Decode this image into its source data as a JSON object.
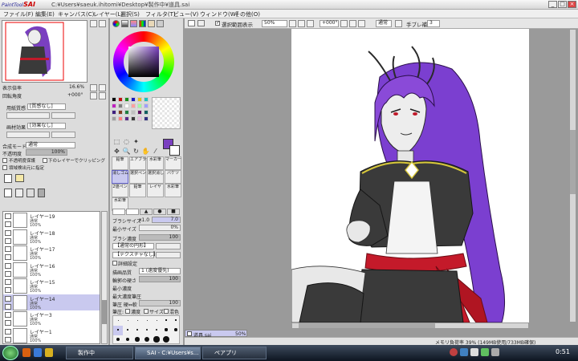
{
  "window": {
    "logo_top": "PaintTool",
    "logo_main": "SAI",
    "title": "C:¥Users¥saeuk.ihitomi¥Desktop¥製作中¥道具.sai",
    "buttons": [
      "_",
      "□",
      "×"
    ]
  },
  "menu": [
    "ファイル(F)",
    "編集(E)",
    "キャンバス(C)",
    "レイヤー(L)",
    "選択(S)",
    "フィルタ(T)",
    "ビュー(V)",
    "ウィンドウ(W)",
    "その他(O)"
  ],
  "navigator": {
    "zoom_label": "表示倍率",
    "zoom_value": "16.6%",
    "angle_label": "回転角度",
    "angle_value": "+000°"
  },
  "layer_props": {
    "paper_label": "用紙質感",
    "paper_value": "[質感なし]",
    "effect_label": "画材効果",
    "effect_value": "[効果なし]",
    "blend_label": "合成モード",
    "blend_value": "通常",
    "opacity_label": "不透明度",
    "opacity_value": "100%",
    "check_protect": "不透明度保護",
    "check_clip": "下のレイヤーでクリッピング",
    "check_select": "領域検出元に指定"
  },
  "layers": [
    {
      "name": "レイヤー19",
      "mode": "通常",
      "opacity": "100%",
      "selected": false
    },
    {
      "name": "レイヤー18",
      "mode": "通常",
      "opacity": "100%",
      "selected": false
    },
    {
      "name": "レイヤー17",
      "mode": "通常",
      "opacity": "100%",
      "selected": false
    },
    {
      "name": "レイヤー16",
      "mode": "通常",
      "opacity": "100%",
      "selected": false
    },
    {
      "name": "レイヤー15",
      "mode": "通常",
      "opacity": "100%",
      "selected": false
    },
    {
      "name": "レイヤー14",
      "mode": "通常",
      "opacity": "100%",
      "selected": true
    },
    {
      "name": "レイヤー3",
      "mode": "通常",
      "opacity": "100%",
      "selected": false
    },
    {
      "name": "レイヤー1",
      "mode": "通常",
      "opacity": "100%",
      "selected": false
    }
  ],
  "brushes": [
    "鉛筆",
    "エアブラシ",
    "水彩筆",
    "マーカー",
    "消しゴム",
    "選択ペン",
    "選択消し",
    "バケツ",
    "2値ペン",
    "鉛筆",
    "レイヤ",
    "水彩筆",
    "水彩筆"
  ],
  "brush_props": {
    "size_label": "ブラシサイズ",
    "size_mult": "x1.0",
    "size_value": "7.0",
    "min_label": "最小サイズ",
    "min_value": "0%",
    "density_label": "ブラシ濃度",
    "density_value": "100",
    "shape_value": "【通常の円形】",
    "texture_value": "【テクスチャなし】",
    "detail_label": "詳細設定",
    "quality_label": "描画品質",
    "quality_value": "1 (速度優先)",
    "edge_label": "輪郭の硬さ",
    "edge_value": "100",
    "mindens_label": "最小濃度",
    "maxpress_label": "最大濃度筆圧",
    "press_label": "筆圧 硬⇔軟",
    "press_value": "100",
    "pressure_label": "筆圧:",
    "pressure_dens": "濃度",
    "pressure_size": "サイズ",
    "pressure_blend": "混色"
  },
  "dot_sizes": [
    "0.7",
    "0.8",
    "1",
    "1.5",
    "2",
    "2.3",
    "2.6",
    "3",
    "3.5",
    "4",
    "5",
    "6",
    "7",
    "8",
    "9",
    "10",
    "12",
    "14",
    "16",
    "20"
  ],
  "canvas_toolbar": {
    "select_display": "選択範囲表示",
    "zoom": "50%",
    "angle": "+000°",
    "mode": "通常",
    "stabilizer_label": "手ブレ補正",
    "stabilizer_value": "3"
  },
  "doc_tab": {
    "name": "道具.sai",
    "zoom": "50%"
  },
  "status": "メモリ負荷率 39% (149MB使用/733MB確保)",
  "taskbar": {
    "tasks": [
      "製作中",
      "SAI - C:¥Users¥s...",
      "ペアプリ"
    ],
    "clock": "0:51"
  },
  "colors": {
    "accent": "#c9c9ef",
    "current_color": "#7a3fc0",
    "palette": [
      "#0a0a0a",
      "#c01010",
      "#1a8c1a",
      "#1a1ac0",
      "#e0c020",
      "#20c0c0",
      "#c020c0",
      "#808080",
      "#ffffff",
      "#ffa0a0",
      "#a0ffa0",
      "#a0a0ff",
      "#402080",
      "#804020",
      "#208040",
      "#c0c0c0",
      "#601060",
      "#106060",
      "#a0a0a0",
      "#ff8080",
      "#5a2a8a",
      "#3a3a3a",
      "#e8c0e0",
      "#303080"
    ]
  }
}
